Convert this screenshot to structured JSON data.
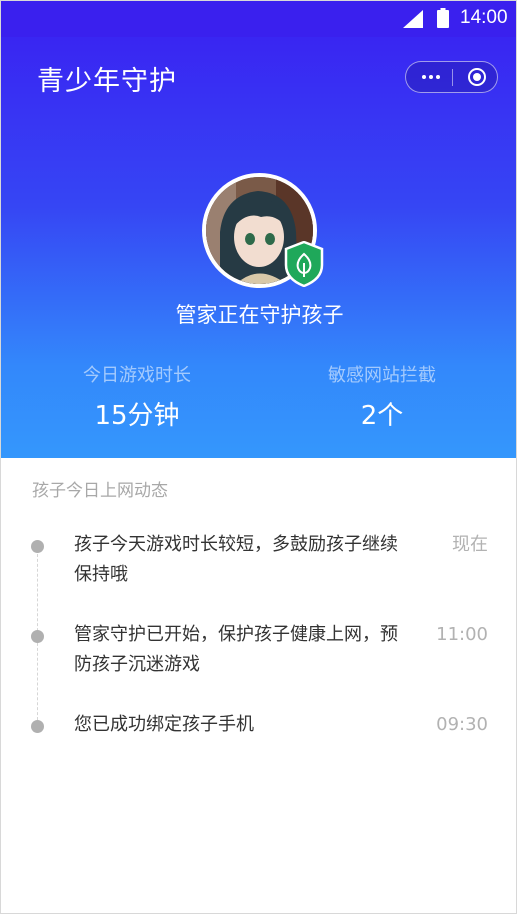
{
  "status_bar": {
    "time": "14:00",
    "signal_icon": "signal-icon",
    "battery_icon": "battery-icon"
  },
  "header": {
    "title": "青少年守护",
    "more_icon": "more-dots-icon",
    "close_icon": "capsule-close-icon"
  },
  "profile": {
    "avatar_icon": "child-avatar",
    "badge_icon": "shield-leaf-icon",
    "status_text": "管家正在守护孩子"
  },
  "stats": [
    {
      "label": "今日游戏时长",
      "value": "15分钟"
    },
    {
      "label": "敏感网站拦截",
      "value": "2个"
    }
  ],
  "activity": {
    "title": "孩子今日上网动态",
    "items": [
      {
        "text": "孩子今天游戏时长较短，多鼓励孩子继续保持哦",
        "time": "现在"
      },
      {
        "text": "管家守护已开始，保护孩子健康上网，预防孩子沉迷游戏",
        "time": "11:00"
      },
      {
        "text": "您已成功绑定孩子手机",
        "time": "09:30"
      }
    ]
  },
  "colors": {
    "gradient_top": "#3a1ff2",
    "gradient_bottom": "#3497fc",
    "shield_green": "#1fa85a",
    "muted_text": "#b2b2b2"
  }
}
